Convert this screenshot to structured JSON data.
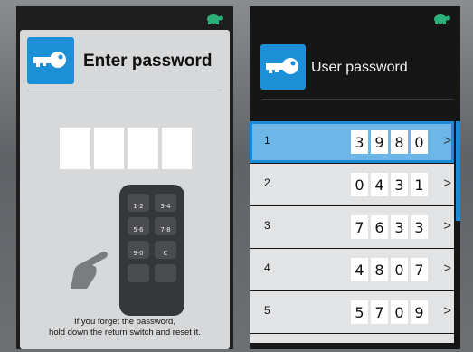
{
  "left_screen": {
    "title": "Enter password",
    "icon": "key-icon",
    "status_icon": "turtle-icon",
    "password_slots": 4,
    "remote_buttons": [
      "1·2",
      "3·4",
      "5·6",
      "7·8",
      "9·0",
      "C",
      "",
      ""
    ],
    "help_text_line1": "If you forget the password,",
    "help_text_line2": "hold down the return switch and reset it."
  },
  "right_screen": {
    "title": "User password",
    "icon": "key-icon",
    "status_icon": "turtle-icon",
    "users": [
      {
        "num": "1",
        "digits": [
          "3",
          "9",
          "8",
          "0"
        ],
        "selected": true
      },
      {
        "num": "2",
        "digits": [
          "0",
          "4",
          "3",
          "1"
        ],
        "selected": false
      },
      {
        "num": "3",
        "digits": [
          "7",
          "6",
          "3",
          "3"
        ],
        "selected": false
      },
      {
        "num": "4",
        "digits": [
          "4",
          "8",
          "0",
          "7"
        ],
        "selected": false
      },
      {
        "num": "5",
        "digits": [
          "5",
          "7",
          "0",
          "9"
        ],
        "selected": false
      }
    ],
    "chevron": ">"
  },
  "colors": {
    "accent": "#1d8fd6",
    "turtle": "#2bb07a",
    "selected_row": "#6cb7e8"
  }
}
